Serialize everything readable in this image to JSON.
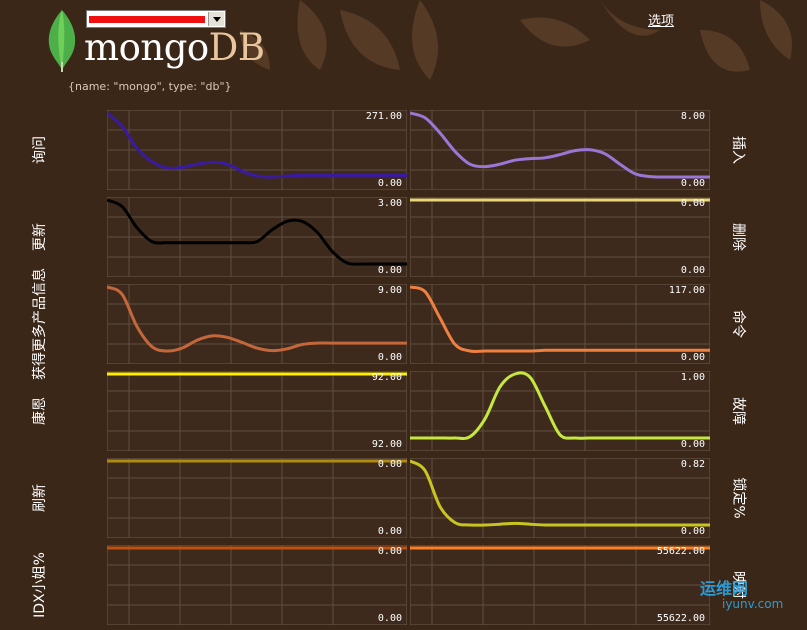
{
  "header": {
    "server_value": "██████████",
    "logo_primary": "mongo",
    "logo_secondary": "DB",
    "options_label": "选项",
    "tagline": "{name: \"mongo\", type: \"db\"}"
  },
  "charts": [
    {
      "id": "query",
      "label": "询问",
      "side": "left",
      "max": "271.00",
      "min": "0.00",
      "color": "#3a1aa0",
      "col": 0,
      "row": 0,
      "series": [
        271,
        230,
        160,
        120,
        100,
        102,
        112,
        118,
        112,
        90,
        75,
        72,
        75,
        77,
        77,
        77,
        77,
        77,
        77,
        77,
        77
      ]
    },
    {
      "id": "insert",
      "label": "插入",
      "side": "right",
      "max": "8.00",
      "min": "0.00",
      "color": "#9a77d6",
      "col": 1,
      "row": 0,
      "series": [
        8,
        7.4,
        5.5,
        3.2,
        1.6,
        1.3,
        1.6,
        2.1,
        2.3,
        2.4,
        2.8,
        3.3,
        3.4,
        2.9,
        1.6,
        0.4,
        0.05,
        0,
        0,
        0,
        0
      ]
    },
    {
      "id": "update",
      "label": "更新",
      "side": "left",
      "max": "3.00",
      "min": "0.00",
      "color": "#000000",
      "col": 0,
      "row": 1,
      "series": [
        3,
        2.7,
        1.7,
        1.05,
        1,
        1,
        1,
        1,
        1,
        1,
        1.05,
        1.6,
        2,
        2,
        1.5,
        0.6,
        0.05,
        0,
        0,
        0,
        0
      ]
    },
    {
      "id": "delete",
      "label": "删除",
      "side": "right",
      "max": "0.00",
      "min": "0.00",
      "color": "#ead67a",
      "col": 1,
      "row": 1,
      "series": [
        1,
        1,
        1,
        1,
        1,
        1,
        1,
        1,
        1,
        1,
        1,
        1,
        1,
        1,
        1,
        1,
        1,
        1,
        1,
        1,
        1
      ]
    },
    {
      "id": "getmore",
      "label": "获得更多产品信息",
      "side": "left",
      "max": "9.00",
      "min": "0.00",
      "color": "#c4673a",
      "col": 0,
      "row": 2,
      "series": [
        9,
        8,
        3.5,
        0.7,
        0.1,
        0.5,
        1.6,
        2.2,
        2,
        1.3,
        0.5,
        0.15,
        0.4,
        1,
        1.2,
        1.2,
        1.2,
        1.2,
        1.2,
        1.2,
        1.2
      ]
    },
    {
      "id": "command",
      "label": "命令",
      "side": "right",
      "max": "117.00",
      "min": "0.00",
      "color": "#f08040",
      "col": 1,
      "row": 2,
      "series": [
        117,
        110,
        70,
        30,
        20,
        20,
        20,
        20,
        20,
        21,
        21,
        21,
        21,
        21,
        21,
        21,
        21,
        21,
        21,
        21,
        21
      ]
    },
    {
      "id": "conn",
      "label": "康恩",
      "side": "left",
      "max": "92.00",
      "min": "92.00",
      "color": "#ffee00",
      "col": 0,
      "row": 3,
      "series": [
        1,
        1,
        1,
        1,
        1,
        1,
        1,
        1,
        1,
        1,
        1,
        1,
        1,
        1,
        1,
        1,
        1,
        1,
        1,
        1,
        1
      ]
    },
    {
      "id": "fault",
      "label": "故障",
      "side": "right",
      "max": "1.00",
      "min": "0.00",
      "color": "#c4e840",
      "col": 1,
      "row": 3,
      "series": [
        0,
        0,
        0,
        0,
        0.02,
        0.3,
        0.8,
        1,
        0.95,
        0.5,
        0.05,
        0,
        0,
        0,
        0,
        0,
        0,
        0,
        0,
        0,
        0
      ]
    },
    {
      "id": "flush",
      "label": "刷新",
      "side": "left",
      "max": "0.00",
      "min": "0.00",
      "color": "#ae8a10",
      "col": 0,
      "row": 4,
      "series": [
        1,
        1,
        1,
        1,
        1,
        1,
        1,
        1,
        1,
        1,
        1,
        1,
        1,
        1,
        1,
        1,
        1,
        1,
        1,
        1,
        1
      ]
    },
    {
      "id": "lock",
      "label": "锁定%",
      "side": "right",
      "max": "0.82",
      "min": "0.00",
      "color": "#c8c420",
      "col": 1,
      "row": 4,
      "series": [
        0.82,
        0.7,
        0.25,
        0.05,
        0.02,
        0.02,
        0.03,
        0.04,
        0.03,
        0.02,
        0.02,
        0.02,
        0.02,
        0.02,
        0.02,
        0.02,
        0.02,
        0.02,
        0.02,
        0.02,
        0.02
      ]
    },
    {
      "id": "idxmiss",
      "label": "IDX小姐%",
      "side": "left",
      "max": "0.00",
      "min": "0.00",
      "color": "#c05010",
      "col": 0,
      "row": 5,
      "series": [
        1,
        1,
        1,
        1,
        1,
        1,
        1,
        1,
        1,
        1,
        1,
        1,
        1,
        1,
        1,
        1,
        1,
        1,
        1,
        1,
        1
      ]
    },
    {
      "id": "mapped",
      "label": "映射",
      "side": "right",
      "max": "55622.00",
      "min": "55622.00",
      "color": "#ff8020",
      "col": 1,
      "row": 5,
      "series": [
        1,
        1,
        1,
        1,
        1,
        1,
        1,
        1,
        1,
        1,
        1,
        1,
        1,
        1,
        1,
        1,
        1,
        1,
        1,
        1,
        1
      ]
    }
  ],
  "watermark": {
    "brand": "运维网",
    "site": "iyunv.com"
  }
}
